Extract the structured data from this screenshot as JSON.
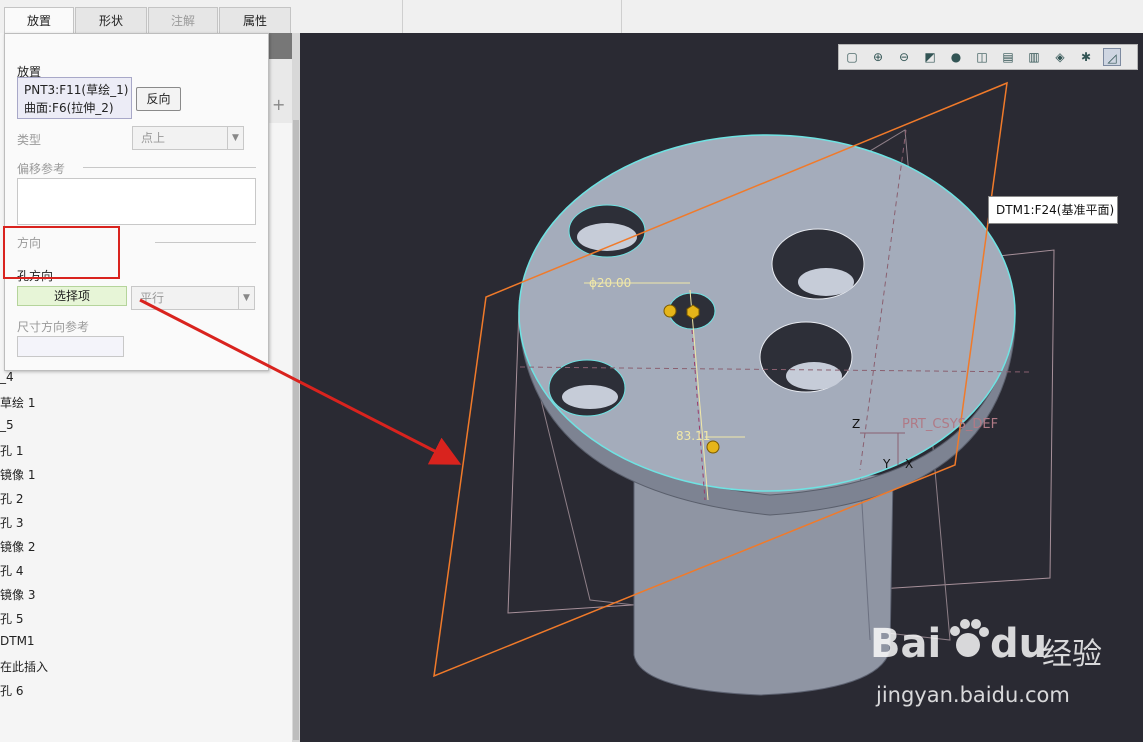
{
  "ribbon": {
    "tabs": [
      {
        "label": "放置",
        "state": "active"
      },
      {
        "label": "形状",
        "state": "normal"
      },
      {
        "label": "注解",
        "state": "disabled"
      },
      {
        "label": "属性",
        "state": "normal"
      }
    ]
  },
  "placement_panel": {
    "placement_label": "放置",
    "references": [
      "PNT3:F11(草绘_1)",
      "曲面:F6(拉伸_2)"
    ],
    "flip_button": "反向",
    "type_label": "类型",
    "type_value": "点上",
    "offset_label": "偏移参考",
    "direction_label": "方向",
    "hole_direction_label": "孔方向",
    "hole_direction_collector": "选择项",
    "hole_direction_mode": "平行",
    "dim_direction_label": "尺寸方向参考"
  },
  "model_tree": {
    "items": [
      "_4",
      "草绘 1",
      "_5",
      "孔 1",
      "镜像 1",
      "孔 2",
      "孔 3",
      "镜像 2",
      "孔 4",
      "镜像 3",
      "孔 5",
      "DTM1",
      "在此插入",
      "孔 6"
    ]
  },
  "viewport": {
    "tooltip": "DTM1:F24(基准平面)",
    "dimension_diameter": "ϕ20.00",
    "dimension_offset": "83.11",
    "csys_label": "PRT_CSYS_DEF",
    "axis_z": "Z",
    "axis_y": "Y",
    "axis_x": "X",
    "background_color": "#2a2a33",
    "model_color": "#a4acbb",
    "edge_highlight_color": "#6fe3e3",
    "datum_selected_color": "#f07a2a"
  },
  "watermark": {
    "brand_prefix": "Bai",
    "brand_suffix": "du",
    "brand_cn": "经验",
    "url": "jingyan.baidu.com"
  },
  "annotation": {
    "highlight_color": "#d9231e"
  }
}
